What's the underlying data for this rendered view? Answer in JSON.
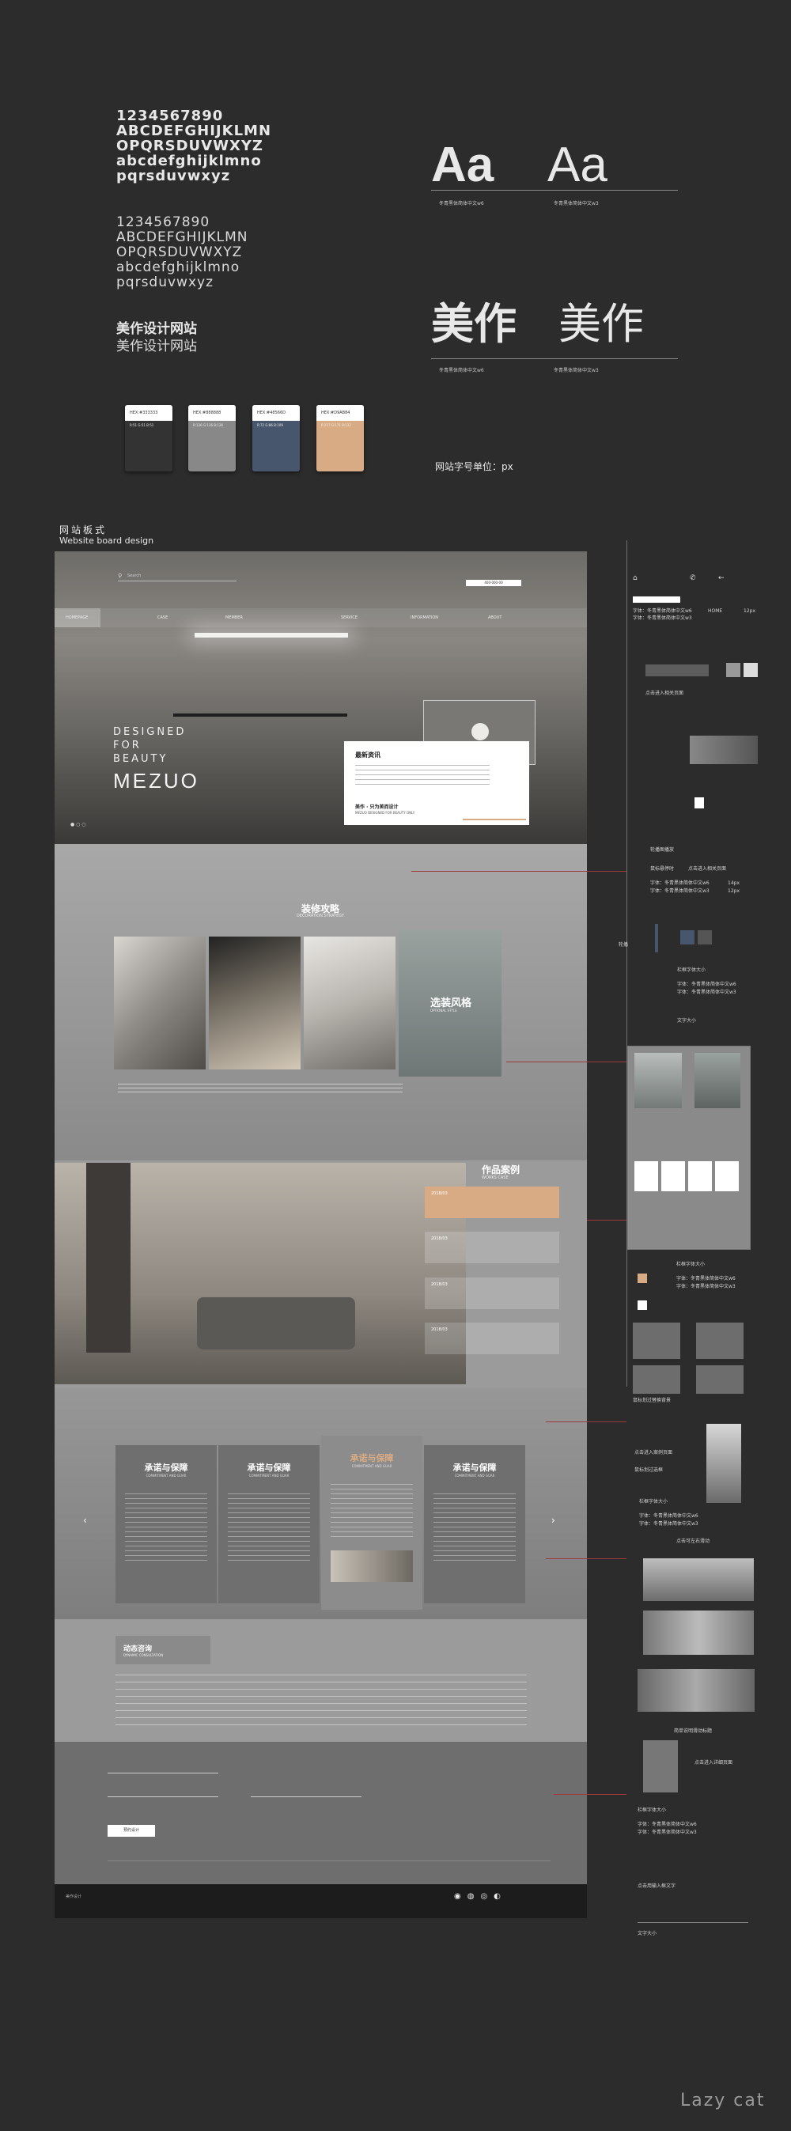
{
  "typography": {
    "bold_lines": [
      "1234567890",
      "ABCDEFGHIJKLMN",
      "OPQRSDUVWXYZ",
      "abcdefghijklmno",
      "pqrsduvwxyz"
    ],
    "light_lines": [
      "1234567890",
      "ABCDEFGHIJKLMN",
      "OPQRSDUVWXYZ",
      "abcdefghijklmno",
      "pqrsduvwxyz"
    ],
    "cn_bold": "美作设计网站",
    "cn_light": "美作设计网站",
    "sample_aa": "Aa",
    "sample_cn": "美作",
    "font_caption": "冬青黑体简体中文w6",
    "font_caption_light": "冬青黑体简体中文w3",
    "unit_note": "网站字号单位：px"
  },
  "swatches": [
    {
      "hex": "HEX:#333333",
      "color": "#333333",
      "info": "R:51 G:51 B:51"
    },
    {
      "hex": "HEX:#888888",
      "color": "#888888",
      "info": "R:136 G:136 B:136"
    },
    {
      "hex": "HEX:#48566D",
      "color": "#48566d",
      "info": "R:72 G:86 B:109"
    },
    {
      "hex": "HEX:#D9AB84",
      "color": "#d9ab84",
      "info": "R:217 G:171 B:132"
    }
  ],
  "board": {
    "title_cn": "网站板式",
    "title_en": "Website board design"
  },
  "site": {
    "search_placeholder": "Search",
    "phone": "400-000-00",
    "nav": [
      "HOMEPAGE",
      "CASE",
      "MEMBER",
      "SERVICE",
      "INFORMATION",
      "ABOUT"
    ],
    "hero_lines": [
      "DESIGNED",
      "FOR",
      "BEAUTY"
    ],
    "brand": "MEZUO",
    "news_title": "最新资讯",
    "news_footer": "美作 · 只为美而设计",
    "news_footer_en": "MEZUO DESIGNED FOR BEAUTY ONLY",
    "deco_title": "装修攻略",
    "deco_en": "DECORATION STRATEGY",
    "style_title": "选装风格",
    "style_en": "OPTIONAL STYLE",
    "works_title": "作品案例",
    "works_en": "WORKS CASE",
    "case_dates": [
      "2018/03",
      "2018/03",
      "2018/03",
      "2018/03"
    ],
    "cards": [
      {
        "title": "承诺与保障",
        "en": "COMMITMENT AND GUAR"
      },
      {
        "title": "承诺与保障",
        "en": "COMMITMENT AND GUAR"
      },
      {
        "title": "承诺与保障",
        "en": "COMMITMENT AND GUAR"
      },
      {
        "title": "承诺与保障",
        "en": "COMMITMENT AND GUAR"
      }
    ],
    "news2_title": "动态咨询",
    "news2_en": "DYNAMIC CONSULTATION",
    "submit": "预约设计",
    "footer_note": "美作设计"
  },
  "annotations": {
    "font_lines": [
      "字体：冬青黑体简体中文w6",
      "字体：冬青黑体简体中文w3"
    ],
    "size_12": "12px",
    "size_14": "14px",
    "notes": [
      "轮播图播放",
      "鼠标悬停时",
      "点击进入相关页面",
      "轮播",
      "栏框字体大小",
      "鼠标划过选框",
      "点击进入案例页面",
      "鼠标划过替换背景",
      "点击可左右滑动",
      "简单说明滑动标题",
      "点击进入详细页面",
      "点击用输入框文字"
    ],
    "home": "HOME",
    "text_size": "文字大小"
  },
  "watermark": "Lazy cat"
}
